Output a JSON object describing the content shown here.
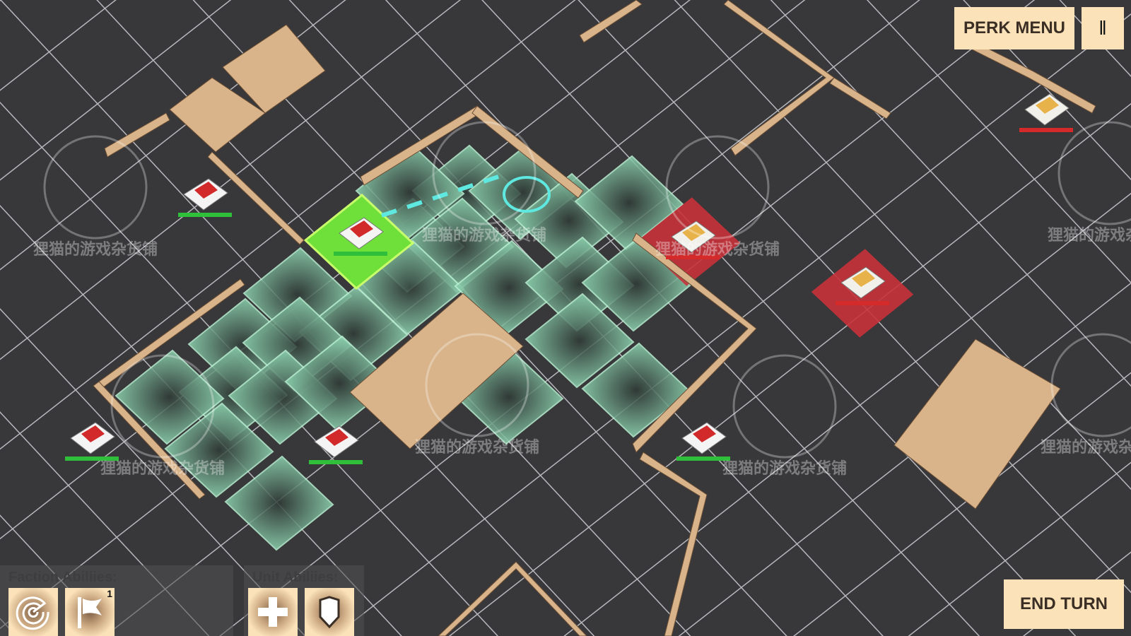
{
  "hud": {
    "perk_menu_label": "PERK MENU",
    "pause_icon": "pause-icon",
    "end_turn_label": "END TURN"
  },
  "faction_abilities": {
    "title": "Faction Abiliies:",
    "items": [
      {
        "name": "radar",
        "icon": "radar-icon"
      },
      {
        "name": "flag",
        "icon": "flag-icon",
        "count": "1"
      }
    ]
  },
  "unit_abilities": {
    "title": "Unit Abiliies:",
    "items": [
      {
        "name": "repair",
        "icon": "plus-icon"
      },
      {
        "name": "shield",
        "icon": "shield-icon"
      }
    ]
  },
  "watermark": "狸猫的游戏杂货铺",
  "colors": {
    "button_bg": "#fbe2b8",
    "move_tile": "#7fc7a3",
    "selected_tile": "#6fe03a",
    "enemy_tile": "#c8323a",
    "ally_health": "#2fbf3a",
    "enemy_health": "#d42a2a",
    "wall": "#d9b48a"
  },
  "units": [
    {
      "team": "player",
      "selected": true
    },
    {
      "team": "player"
    },
    {
      "team": "player"
    },
    {
      "team": "player"
    },
    {
      "team": "player"
    },
    {
      "team": "enemy"
    },
    {
      "team": "enemy"
    },
    {
      "team": "enemy"
    }
  ]
}
